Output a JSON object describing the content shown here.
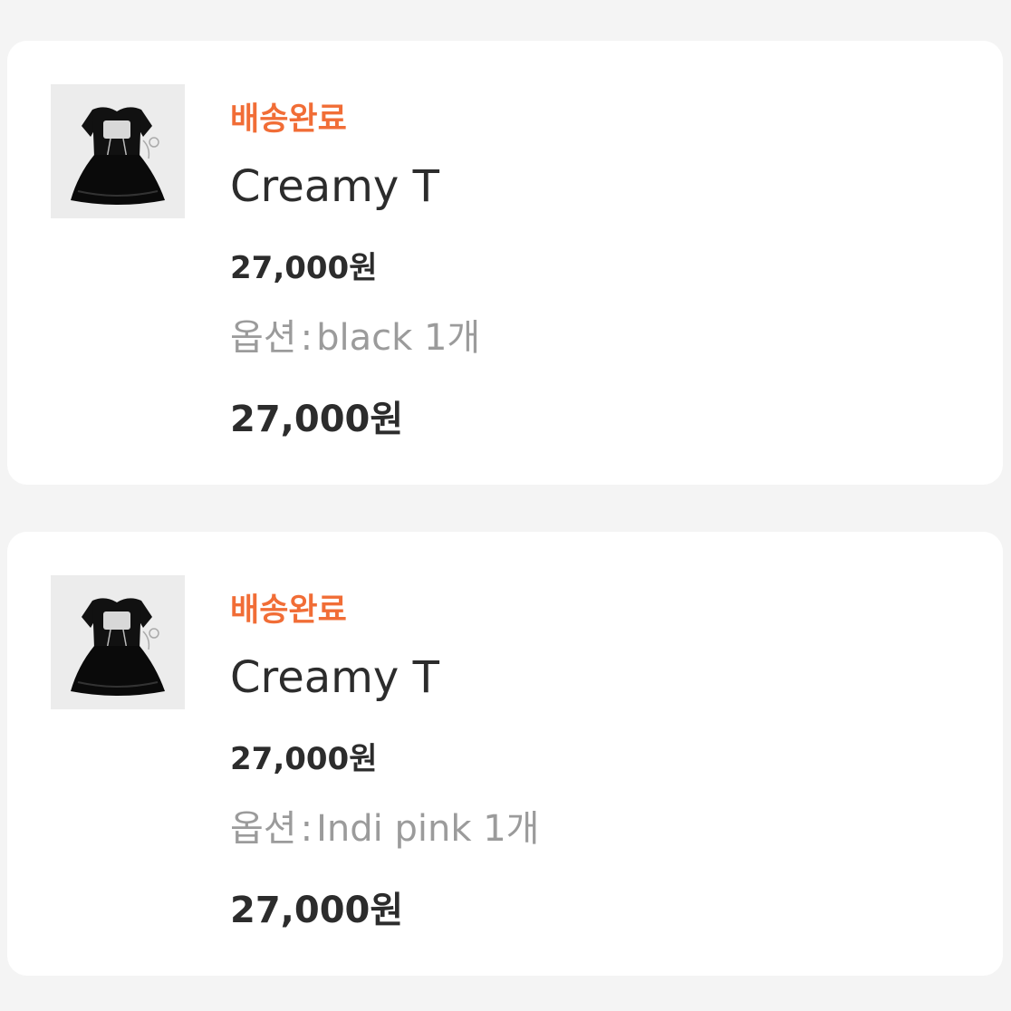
{
  "orders": [
    {
      "status": "배송완료",
      "product_name": "Creamy T",
      "unit_price": "27,000원",
      "option_label": "옵션",
      "option_separator": ":",
      "option_value": "black 1개",
      "total_price": "27,000원",
      "thumbnail_icon": "black-dress-product-image"
    },
    {
      "status": "배송완료",
      "product_name": "Creamy T",
      "unit_price": "27,000원",
      "option_label": "옵션",
      "option_separator": ":",
      "option_value": "Indi pink 1개",
      "total_price": "27,000원",
      "thumbnail_icon": "black-dress-product-image"
    }
  ],
  "colors": {
    "status": "#f16d36",
    "text_primary": "#2c2c2c",
    "text_secondary": "#9b9b9b",
    "card_background": "#ffffff",
    "page_background": "#f4f4f4"
  }
}
